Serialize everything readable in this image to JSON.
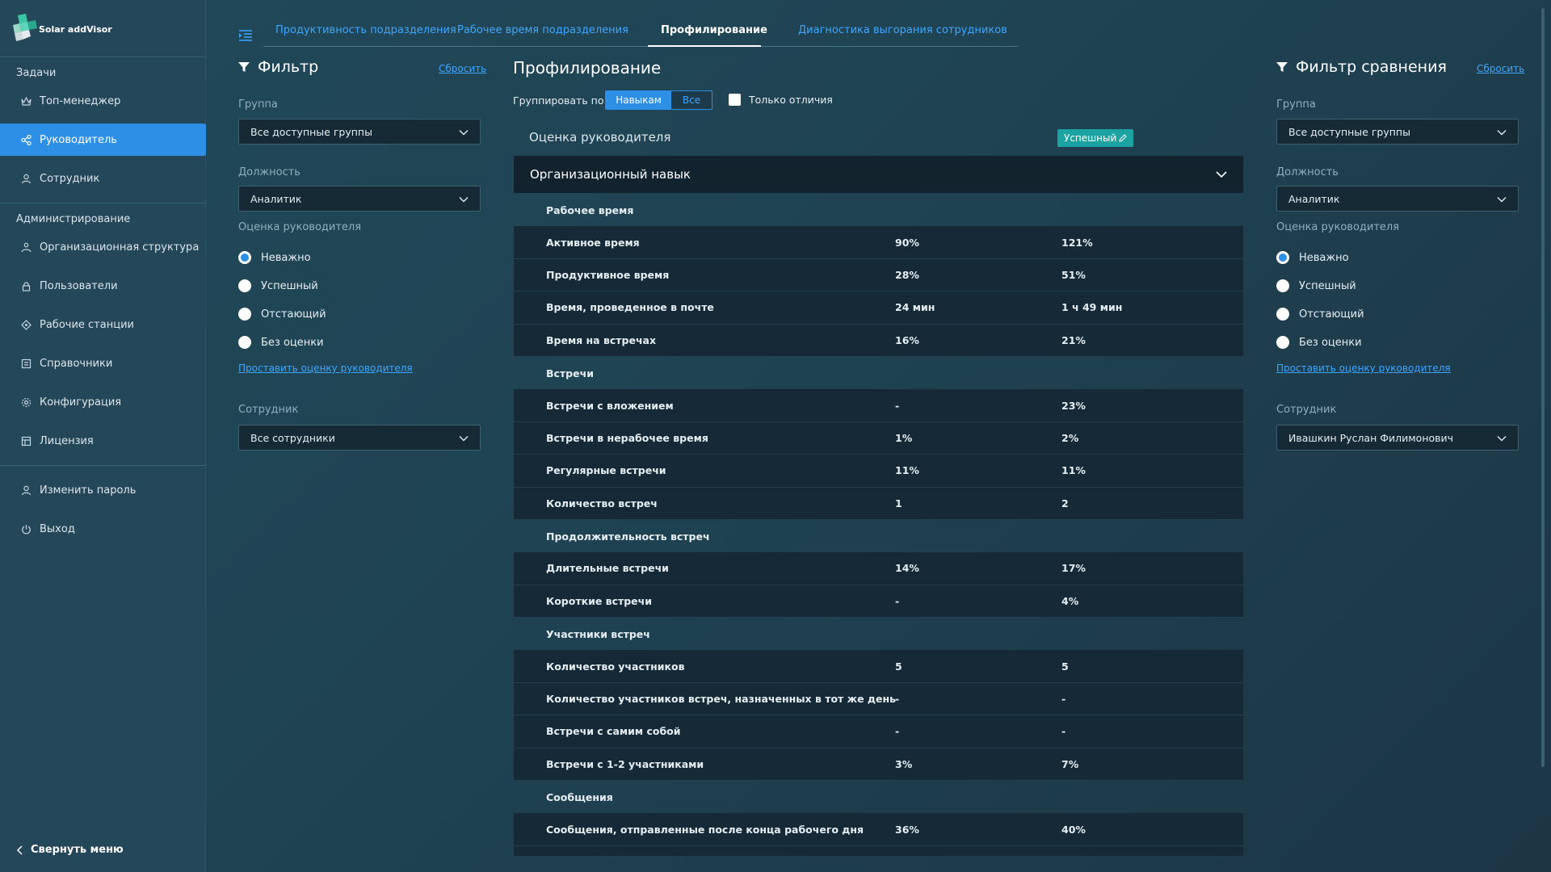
{
  "app": {
    "name": "Solar addVisor"
  },
  "sidebar": {
    "sections": [
      {
        "label": "Задачи"
      },
      {
        "label": "Администрирование"
      }
    ],
    "items": [
      {
        "label": "Топ-менеджер",
        "icon": "crown-icon"
      },
      {
        "label": "Руководитель",
        "icon": "share-icon",
        "active": true
      },
      {
        "label": "Сотрудник",
        "icon": "user-icon"
      },
      {
        "label": "Организационная структура",
        "icon": "org-icon"
      },
      {
        "label": "Пользователи",
        "icon": "lock-icon"
      },
      {
        "label": "Рабочие станции",
        "icon": "workstation-icon"
      },
      {
        "label": "Справочники",
        "icon": "book-icon"
      },
      {
        "label": "Конфигурация",
        "icon": "gear-icon"
      },
      {
        "label": "Лицензия",
        "icon": "license-icon"
      },
      {
        "label": "Изменить пароль",
        "icon": "user-key-icon"
      },
      {
        "label": "Выход",
        "icon": "power-icon"
      }
    ],
    "collapse_label": "Свернуть меню"
  },
  "tabs": [
    {
      "label": "Продуктивность подразделения"
    },
    {
      "label": "Рабочее время подразделения"
    },
    {
      "label": "Профилирование",
      "active": true
    },
    {
      "label": "Диагностика выгорания сотрудников"
    }
  ],
  "filter": {
    "title": "Фильтр",
    "reset": "Сбросить",
    "group_label": "Группа",
    "group_value": "Все доступные группы",
    "position_label": "Должность",
    "position_value": "Аналитик",
    "rating_label": "Оценка руководителя",
    "rating_options": [
      "Неважно",
      "Успешный",
      "Отстающий",
      "Без оценки"
    ],
    "rating_selected": "Неважно",
    "rating_link": "Проставить оценку руководителя",
    "employee_label": "Сотрудник",
    "employee_value": "Все сотрудники"
  },
  "compare_filter": {
    "title": "Фильтр сравнения",
    "reset": "Сбросить",
    "group_label": "Группа",
    "group_value": "Все доступные группы",
    "position_label": "Должность",
    "position_value": "Аналитик",
    "rating_label": "Оценка руководителя",
    "rating_options": [
      "Неважно",
      "Успешный",
      "Отстающий",
      "Без оценки"
    ],
    "rating_selected": "Неважно",
    "rating_link": "Проставить оценку руководителя",
    "employee_label": "Сотрудник",
    "employee_value": "Ивашкин Руслан Филимонович"
  },
  "main": {
    "title": "Профилирование",
    "group_by_label": "Группировать по:",
    "group_by_options": [
      "Навыкам",
      "Все"
    ],
    "group_by_selected": "Навыкам",
    "only_diff_label": "Только отличия",
    "assessment_label": "Оценка руководителя",
    "assessment_badge": "Успешный",
    "skill_header": "Организационный навык",
    "rows": [
      {
        "type": "group",
        "label": "Рабочее время"
      },
      {
        "type": "data",
        "label": "Активное время",
        "a": "90%",
        "b": "121%"
      },
      {
        "type": "data",
        "label": "Продуктивное время",
        "a": "28%",
        "b": "51%"
      },
      {
        "type": "data",
        "label": "Время, проведенное в почте",
        "a": "24 мин",
        "b": "1 ч 49 мин"
      },
      {
        "type": "data",
        "label": "Время на встречах",
        "a": "16%",
        "b": "21%"
      },
      {
        "type": "group",
        "label": "Встречи"
      },
      {
        "type": "data",
        "label": "Встречи с вложением",
        "a": "-",
        "b": "23%"
      },
      {
        "type": "data",
        "label": "Встречи в нерабочее время",
        "a": "1%",
        "b": "2%"
      },
      {
        "type": "data",
        "label": "Регулярные встречи",
        "a": "11%",
        "b": "11%"
      },
      {
        "type": "data",
        "label": "Количество встреч",
        "a": "1",
        "b": "2"
      },
      {
        "type": "group",
        "label": "Продолжительность встреч"
      },
      {
        "type": "data",
        "label": "Длительные встречи",
        "a": "14%",
        "b": "17%"
      },
      {
        "type": "data",
        "label": "Короткие встречи",
        "a": "-",
        "b": "4%"
      },
      {
        "type": "group",
        "label": "Участники встреч"
      },
      {
        "type": "data",
        "label": "Количество участников",
        "a": "5",
        "b": "5"
      },
      {
        "type": "data",
        "label": "Количество участников встреч, назначенных в тот же день",
        "a": "-",
        "b": "-"
      },
      {
        "type": "data",
        "label": "Встречи с самим собой",
        "a": "-",
        "b": "-"
      },
      {
        "type": "data",
        "label": "Встречи с 1-2 участниками",
        "a": "3%",
        "b": "7%"
      },
      {
        "type": "group",
        "label": "Сообщения"
      },
      {
        "type": "data",
        "label": "Сообщения, отправленные после конца рабочего дня",
        "a": "36%",
        "b": "40%"
      },
      {
        "type": "data",
        "label": "",
        "a": "",
        "b": ""
      }
    ]
  }
}
